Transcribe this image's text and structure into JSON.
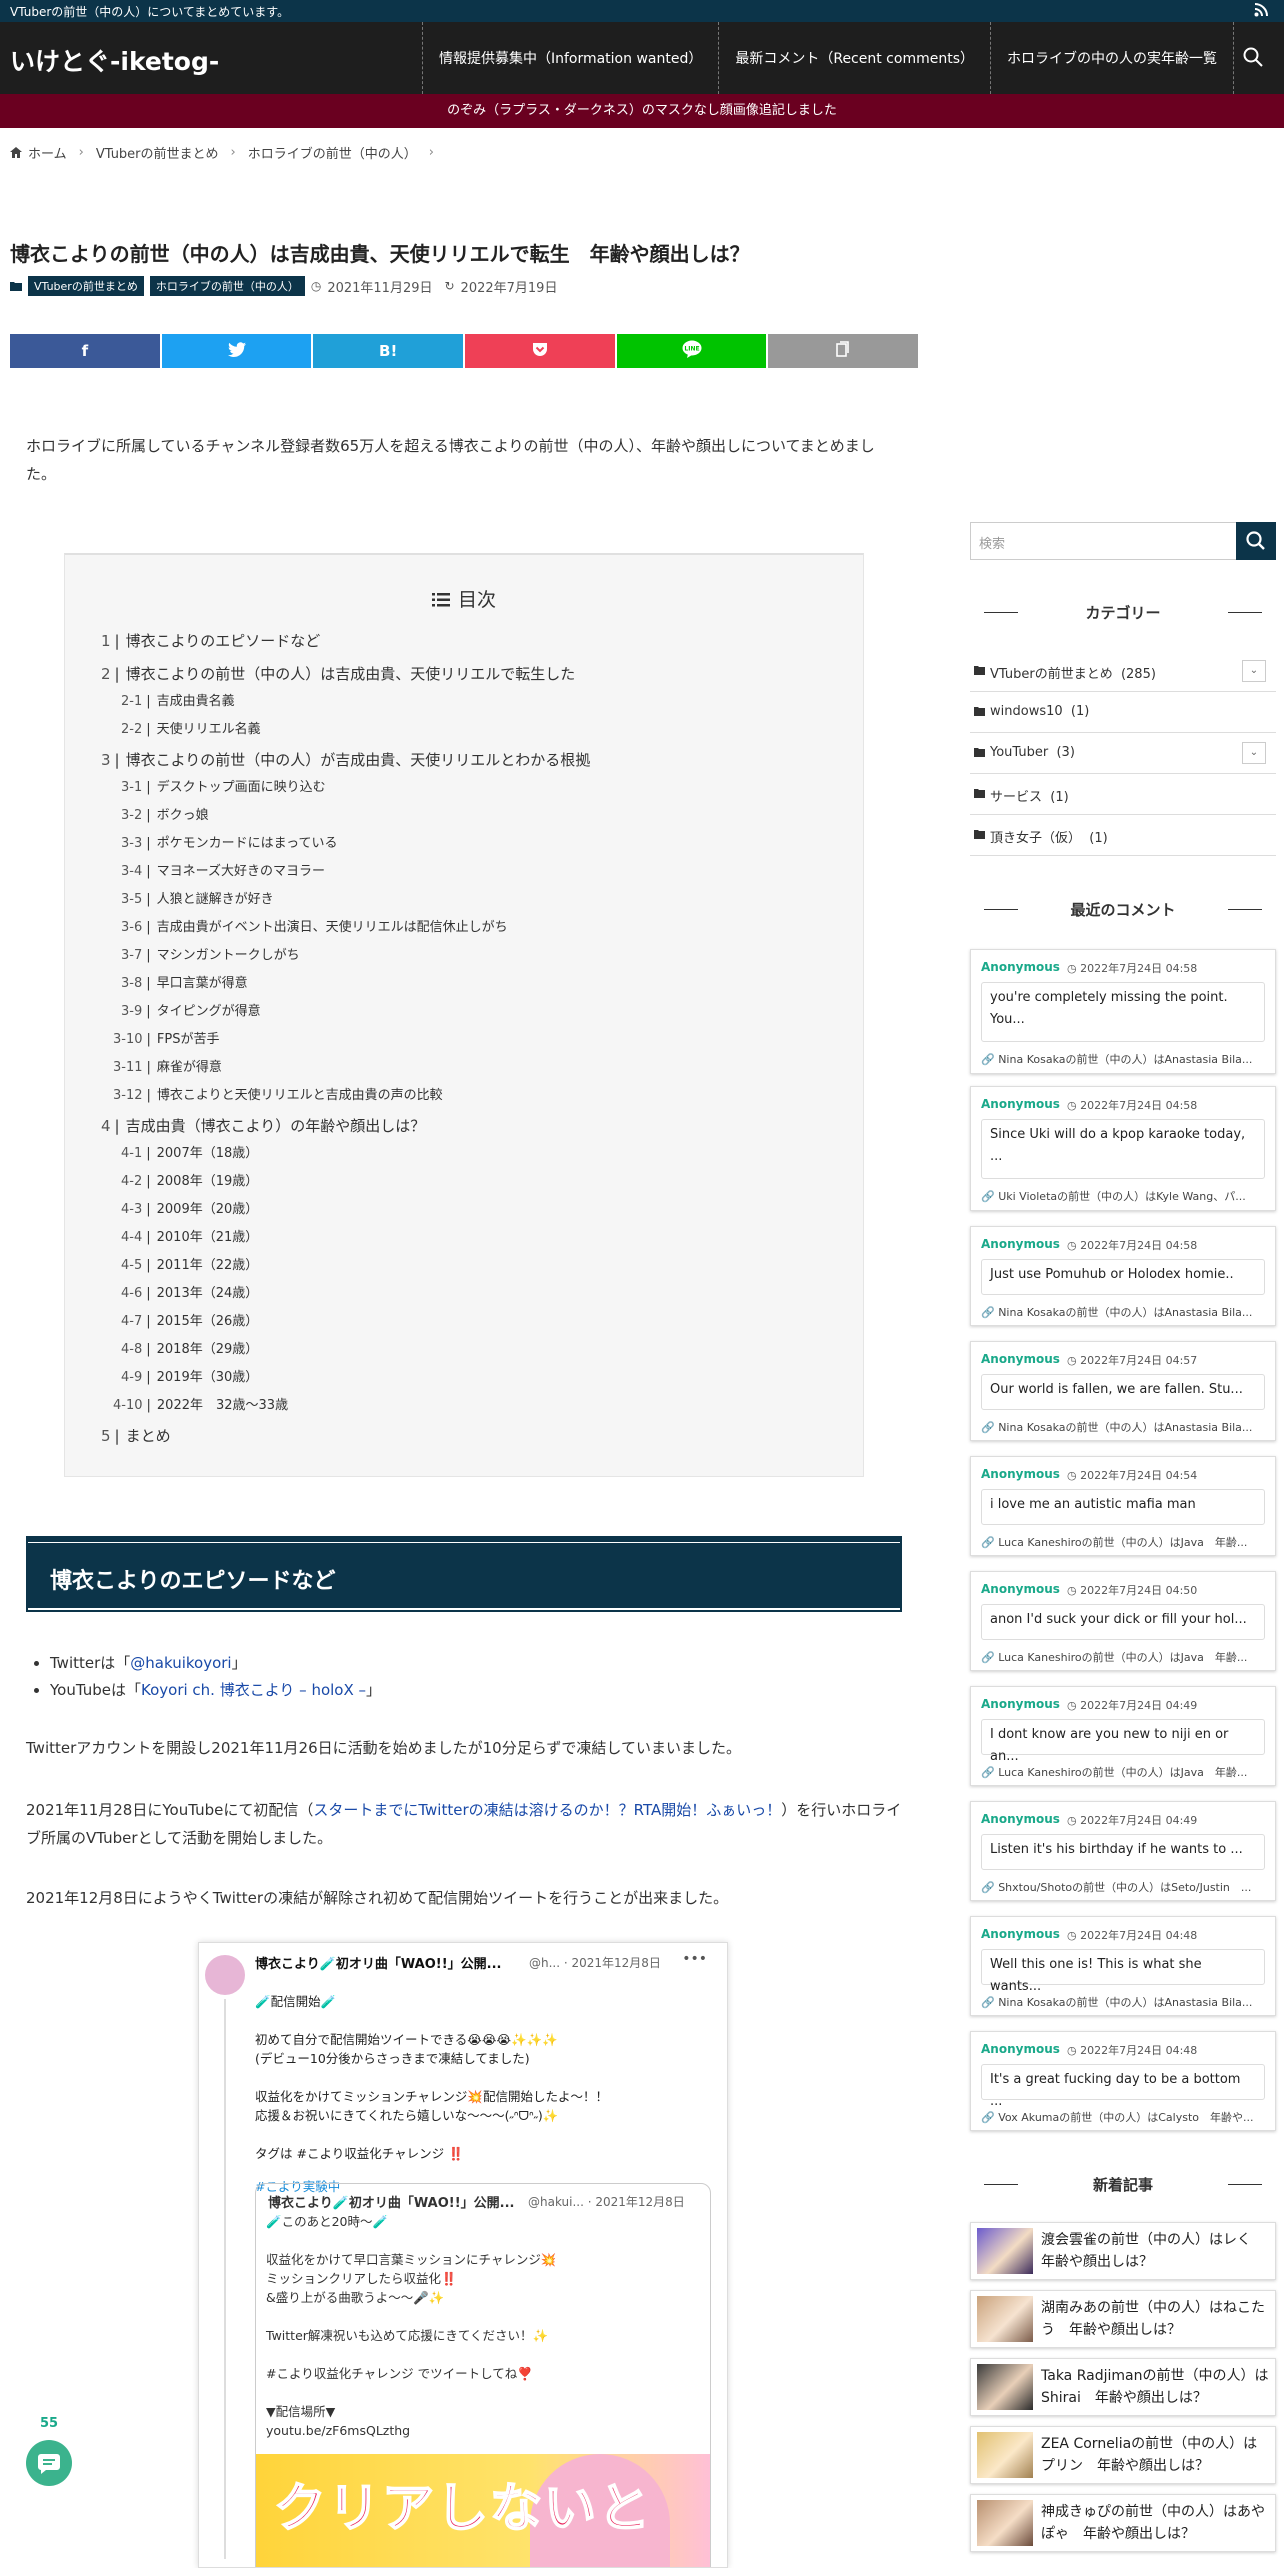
{
  "topbar": {
    "text": "VTuberの前世（中の人）についてまとめています。"
  },
  "header": {
    "logo": "いけとぐ-iketog-",
    "nav": [
      "情報提供募集中（Information wanted）",
      "最新コメント（Recent comments）",
      "ホロライブの中の人の実年齢一覧"
    ]
  },
  "notice": "のぞみ（ラプラス・ダークネス）のマスクなし顔画像追記しました",
  "breadcrumb": [
    "ホーム",
    "VTuberの前世まとめ",
    "ホロライブの前世（中の人）"
  ],
  "article": {
    "title": "博衣こよりの前世（中の人）は吉成由貴、天使リリエルで転生　年齢や顔出しは？",
    "tags": [
      "VTuberの前世まとめ",
      "ホロライブの前世（中の人）"
    ],
    "published": "2021年11月29日",
    "updated": "2022年7月19日",
    "share": [
      "f",
      "t",
      "B!",
      "p",
      "LINE",
      "copy"
    ],
    "intro": "ホロライブに所属しているチャンネル登録者数65万人を超える博衣こよりの前世（中の人）、年齢や顔出しについてまとめました。"
  },
  "toc": {
    "title": "目次",
    "items": [
      {
        "n": "1",
        "t": "博衣こよりのエピソードなど",
        "sub": []
      },
      {
        "n": "2",
        "t": "博衣こよりの前世（中の人）は吉成由貴、天使リリエルで転生した",
        "sub": [
          {
            "n": "2-1",
            "t": "吉成由貴名義"
          },
          {
            "n": "2-2",
            "t": "天使リリエル名義"
          }
        ]
      },
      {
        "n": "3",
        "t": "博衣こよりの前世（中の人）が吉成由貴、天使リリエルとわかる根拠",
        "sub": [
          {
            "n": "3-1",
            "t": "デスクトップ画面に映り込む"
          },
          {
            "n": "3-2",
            "t": "ボクっ娘"
          },
          {
            "n": "3-3",
            "t": "ポケモンカードにはまっている"
          },
          {
            "n": "3-4",
            "t": "マヨネーズ大好きのマヨラー"
          },
          {
            "n": "3-5",
            "t": "人狼と謎解きが好き"
          },
          {
            "n": "3-6",
            "t": "吉成由貴がイベント出演日、天使リリエルは配信休止しがち"
          },
          {
            "n": "3-7",
            "t": "マシンガントークしがち"
          },
          {
            "n": "3-8",
            "t": "早口言葉が得意"
          },
          {
            "n": "3-9",
            "t": "タイピングが得意"
          },
          {
            "n": "3-10",
            "t": "FPSが苦手"
          },
          {
            "n": "3-11",
            "t": "麻雀が得意"
          },
          {
            "n": "3-12",
            "t": "博衣こよりと天使リリエルと吉成由貴の声の比較"
          }
        ]
      },
      {
        "n": "4",
        "t": "吉成由貴（博衣こより）の年齢や顔出しは？",
        "sub": [
          {
            "n": "4-1",
            "t": "2007年（18歳）"
          },
          {
            "n": "4-2",
            "t": "2008年（19歳）"
          },
          {
            "n": "4-3",
            "t": "2009年（20歳）"
          },
          {
            "n": "4-4",
            "t": "2010年（21歳）"
          },
          {
            "n": "4-5",
            "t": "2011年（22歳）"
          },
          {
            "n": "4-6",
            "t": "2013年（24歳）"
          },
          {
            "n": "4-7",
            "t": "2015年（26歳）"
          },
          {
            "n": "4-8",
            "t": "2018年（29歳）"
          },
          {
            "n": "4-9",
            "t": "2019年（30歳）"
          },
          {
            "n": "4-10",
            "t": "2022年　32歳～33歳"
          }
        ]
      },
      {
        "n": "5",
        "t": "まとめ",
        "sub": []
      }
    ]
  },
  "section1": {
    "heading": "博衣こよりのエピソードなど",
    "twitter_prefix": "Twitterは「",
    "twitter_link": "@hakuikoyori",
    "twitter_suffix": "」",
    "youtube_prefix": "YouTubeは「",
    "youtube_link": "Koyori ch. 博衣こより – holoX –",
    "youtube_suffix": "」",
    "p1": "Twitterアカウントを開設し2021年11月26日に活動を始めましたが10分足らずで凍結していまいました。",
    "p2_pre": "2021年11月28日にYouTubeにて初配信（",
    "p2_link": "スタートまでにTwitterの凍結は溶けるのか！？RTA開始！ふぁいっ！",
    "p2_post": "）を行いホロライブ所属のVTuberとして活動を開始しました。",
    "p3": "2021年12月8日にようやくTwitterの凍結が解除され初めて配信開始ツイートを行うことが出来ました。"
  },
  "tweet": {
    "name": "博衣こより🧪初オリ曲「WAO!!」公開...",
    "meta": "@h... · 2021年12月8日",
    "body": "🧪配信開始🧪\n\n初めて自分で配信開始ツイートできる😭😭😭✨✨✨\n(デビュー10分後からさっきまで凍結してました)\n\n収益化をかけてミッションチャレンジ💥配信開始したよ～！！\n応援＆お祝いにきてくれたら嬉しいな～～～(˶ᐢᗜᐢ˶)✨\n\nタグは #こより収益化チャレンジ ‼️",
    "hashtag": "#こより実験中",
    "quote_name": "博衣こより🧪初オリ曲「WAO!!」公開...",
    "quote_meta": "@hakui... · 2021年12月8日",
    "quote_body": "🧪このあと20時～🧪\n\n収益化をかけて早口言葉ミッションにチャレンジ💥\nミッションクリアしたら収益化‼️\n&盛り上がる曲歌うよ～～🎤✨\n\nTwitter解凍祝いも込めて応援にきてください！✨\n\n#こより収益化チャレンジ でツイートしてね❣️\n\n▼配信場所▼\nyoutu.be/zF6msQLzthg",
    "image_text": "クリアしないと"
  },
  "floating": {
    "counter": "55"
  },
  "sidebar": {
    "search_placeholder": "検索",
    "categories_title": "カテゴリー",
    "categories": [
      {
        "label": "VTuberの前世まとめ",
        "count": "(285)",
        "toggle": true
      },
      {
        "label": "windows10",
        "count": "(1)",
        "toggle": false
      },
      {
        "label": "YouTuber",
        "count": "(3)",
        "toggle": true
      },
      {
        "label": "サービス",
        "count": "(1)",
        "toggle": false
      },
      {
        "label": "頂き女子（仮）",
        "count": "(1)",
        "toggle": false
      }
    ],
    "comments_title": "最近のコメント",
    "comments": [
      {
        "author": "Anonymous",
        "date": "2022年7月24日 04:58",
        "text": "you're completely missing the point. You...",
        "post": "Nina Kosakaの前世（中の人）はAnastasia Bila..."
      },
      {
        "author": "Anonymous",
        "date": "2022年7月24日 04:58",
        "text": "Since Uki will do a kpop karaoke today, ...",
        "post": "Uki Violetaの前世（中の人）はKyle Wang、パ..."
      },
      {
        "author": "Anonymous",
        "date": "2022年7月24日 04:58",
        "text": "Just use Pomuhub or Holodex homie..",
        "post": "Nina Kosakaの前世（中の人）はAnastasia Bila..."
      },
      {
        "author": "Anonymous",
        "date": "2022年7月24日 04:57",
        "text": "Our world is fallen, we are fallen. Stu...",
        "post": "Nina Kosakaの前世（中の人）はAnastasia Bila..."
      },
      {
        "author": "Anonymous",
        "date": "2022年7月24日 04:54",
        "text": "i love me an autistic mafia man",
        "post": "Luca Kaneshiroの前世（中の人）はJava　年齢..."
      },
      {
        "author": "Anonymous",
        "date": "2022年7月24日 04:50",
        "text": "anon I'd suck your dick or fill your hol...",
        "post": "Luca Kaneshiroの前世（中の人）はJava　年齢..."
      },
      {
        "author": "Anonymous",
        "date": "2022年7月24日 04:49",
        "text": "I dont know are you new to niji en or an...",
        "post": "Luca Kaneshiroの前世（中の人）はJava　年齢..."
      },
      {
        "author": "Anonymous",
        "date": "2022年7月24日 04:49",
        "text": "Listen it's his birthday if he wants to ...",
        "post": "Shxtou/Shotoの前世（中の人）はSeto/Justin　..."
      },
      {
        "author": "Anonymous",
        "date": "2022年7月24日 04:48",
        "text": "Well this one is! This is what she wants...",
        "post": "Nina Kosakaの前世（中の人）はAnastasia Bila..."
      },
      {
        "author": "Anonymous",
        "date": "2022年7月24日 04:48",
        "text": "It's a great fucking day to be a bottom ...",
        "post": "Vox Akumaの前世（中の人）はCalysto　年齢や..."
      }
    ],
    "new_title": "新着記事",
    "new_posts": [
      "渡会雲雀の前世（中の人）はレく　年齢や顔出しは？",
      "湖南みあの前世（中の人）はねこたう　年齢や顔出しは？",
      "Taka Radjimanの前世（中の人）はShirai　年齢や顔出しは？",
      "ZEA Corneliaの前世（中の人）はプリン　年齢や顔出しは？",
      "神成きゅぴの前世（中の人）はあやぽゃ　年齢や顔出しは？"
    ]
  },
  "colors": {
    "navy": "#0c3449",
    "maroon": "#6a0020",
    "teal": "#1aa98a",
    "link": "#1a4aa8"
  }
}
